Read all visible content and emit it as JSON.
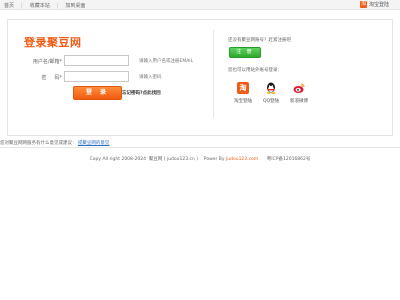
{
  "topbar": {
    "links": [
      "首页",
      "收藏本站",
      "加到桌面"
    ],
    "taobao_login": "淘宝登陆"
  },
  "login": {
    "title": "登录聚豆网",
    "username_label": "用户名/邮箱*",
    "username_value": "",
    "username_hint": "请输入用户名或注册EMAIL",
    "password_label": "密     码*",
    "password_value": "",
    "password_hint": "请输入密码",
    "submit_label": "登 录",
    "forgot_label": "忘记密码?点此找回"
  },
  "register": {
    "question": "还没有聚豆网账号？赶紧注册吧",
    "button_label": "注 册",
    "other_login": "您也可以用站外账号登录："
  },
  "social": [
    {
      "label": "淘宝登陆",
      "icon": "taobao-icon"
    },
    {
      "label": "QQ登陆",
      "icon": "qq-icon"
    },
    {
      "label": "新浪微博",
      "icon": "weibo-icon"
    }
  ],
  "feedback": {
    "text": "您对聚豆网网服务有什么意见或建议：",
    "link": "提聚豆网的意见"
  },
  "footer": {
    "prefix": "Copy All right 2008-2024  聚豆网 ( judou123.cn )    Power By",
    "brand": "judou123.com",
    "icp": "     粤ICP备12016862号"
  },
  "colors": {
    "accent": "#f35a13",
    "register_green": "#2fa82f",
    "link_blue": "#2a6fc7"
  }
}
